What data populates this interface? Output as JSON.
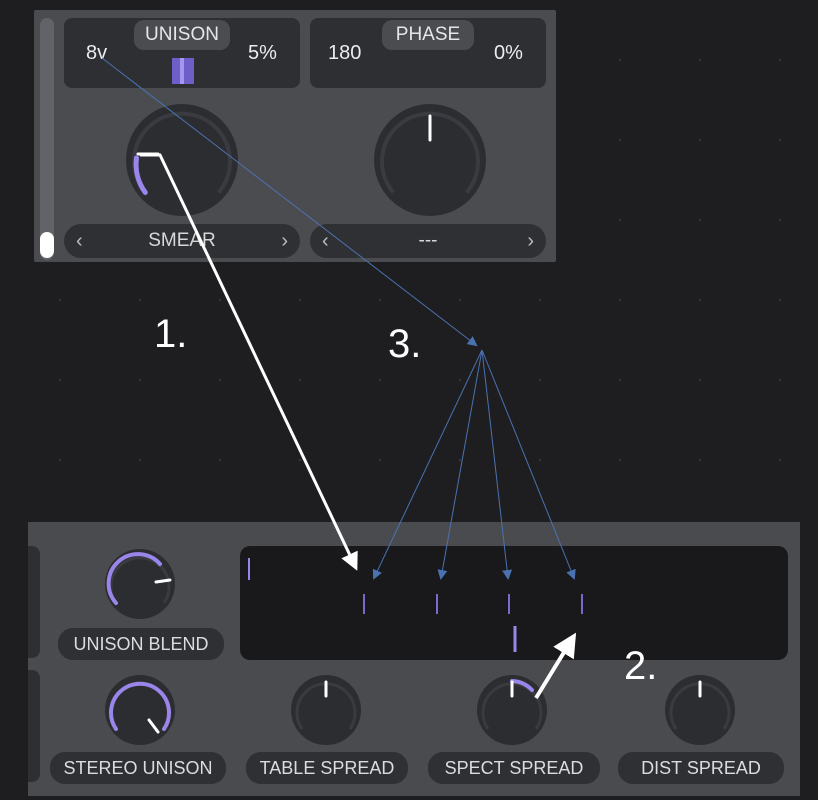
{
  "unison": {
    "title": "UNISON",
    "voices": "8v",
    "detune": "5%",
    "mode_label": "SMEAR"
  },
  "phase": {
    "title": "PHASE",
    "degrees": "180",
    "random": "0%",
    "mode_label": "---"
  },
  "annotations": {
    "step1": "1.",
    "step2": "2.",
    "step3": "3."
  },
  "controls": {
    "unison_blend": "UNISON BLEND",
    "stereo_unison": "STEREO UNISON",
    "table_spread": "TABLE SPREAD",
    "spect_spread": "SPECT SPREAD",
    "dist_spread": "DIST SPREAD"
  },
  "colors": {
    "accent": "#9a86ea",
    "arrow_blue": "#4a72b0",
    "arrow_white": "#ffffff"
  }
}
